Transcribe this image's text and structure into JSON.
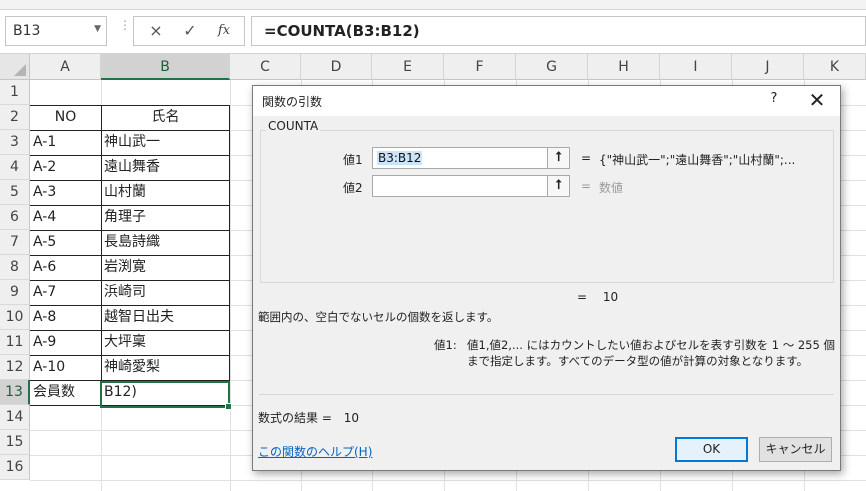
{
  "formula_bar": {
    "name_box": "B13",
    "cancel_icon": "×",
    "enter_icon": "✓",
    "fx_label": "fx",
    "formula": "=COUNTA(B3:B12)"
  },
  "sheet": {
    "columns": [
      "A",
      "B",
      "C",
      "D",
      "E",
      "F",
      "G",
      "H",
      "I",
      "J",
      "K"
    ],
    "rows": [
      "1",
      "2",
      "3",
      "4",
      "5",
      "6",
      "7",
      "8",
      "9",
      "10",
      "11",
      "12",
      "13",
      "14",
      "15",
      "16"
    ],
    "header": {
      "no": "NO",
      "name": "氏名"
    },
    "records": [
      {
        "no": "A-1",
        "name": "神山武一"
      },
      {
        "no": "A-2",
        "name": "遠山舞香"
      },
      {
        "no": "A-3",
        "name": "山村蘭"
      },
      {
        "no": "A-4",
        "name": "角理子"
      },
      {
        "no": "A-5",
        "name": "長島詩織"
      },
      {
        "no": "A-6",
        "name": "岩渕寛"
      },
      {
        "no": "A-7",
        "name": "浜崎司"
      },
      {
        "no": "A-8",
        "name": "越智日出夫"
      },
      {
        "no": "A-9",
        "name": "大坪稟"
      },
      {
        "no": "A-10",
        "name": "神崎愛梨"
      }
    ],
    "total_label": "会員数",
    "active_cell_text": "B12)"
  },
  "dialog": {
    "title": "関数の引数",
    "help_icon": "?",
    "close_icon": "✕",
    "function_name": "COUNTA",
    "arg1_label": "値1",
    "arg1_value": "B3:B12",
    "arg1_result": "{\"神山武一\";\"遠山舞香\";\"山村蘭\";...",
    "arg2_label": "値2",
    "arg2_value": "",
    "arg2_result": "数値",
    "equals": "=",
    "result_value": "10",
    "function_description": "範囲内の、空白でないセルの個数を返します。",
    "arg_desc_name": "値1:",
    "arg_desc_text": "値1,値2,... にはカウントしたい値およびセルを表す引数を 1 ～ 255 個まで指定します。すべてのデータ型の値が計算の対象となります。",
    "formula_result_label": "数式の結果 =",
    "formula_result_value": "10",
    "help_link": "この関数のヘルプ(H)",
    "ok_label": "OK",
    "cancel_label": "キャンセル"
  },
  "colors": {
    "accent_green": "#217346",
    "link_blue": "#0563c1",
    "ok_border": "#0078d7"
  }
}
